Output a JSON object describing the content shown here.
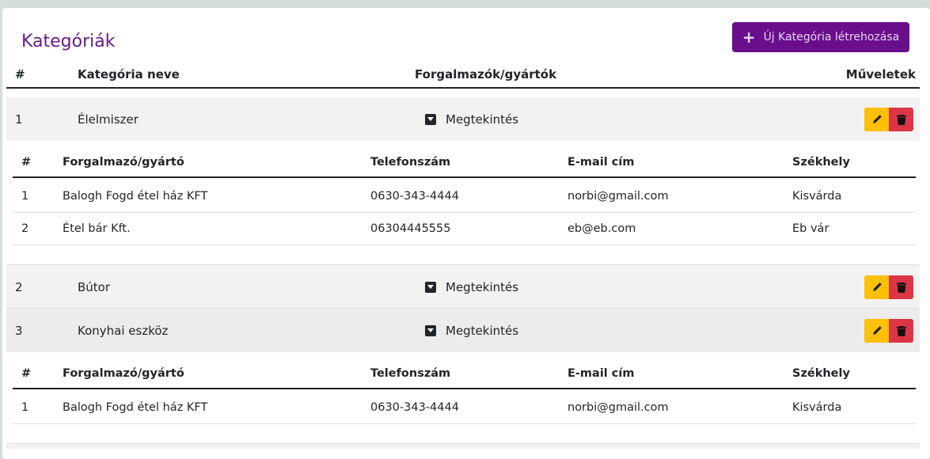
{
  "page": {
    "title": "Kategóriák",
    "new_button_label": "Új Kategória létrehozása",
    "new_button_icon": "plus-icon",
    "accent_color": "#6a0e8c",
    "edit_color": "#ffc107",
    "delete_color": "#dc3545"
  },
  "main_table": {
    "headers": [
      "#",
      "Kategória neve",
      "Forgalmazók/gyártók",
      "Műveletek"
    ],
    "rows": [
      {
        "id": "1",
        "name": "Élelmiszer",
        "toggle_label": "Megtekintés",
        "expanded": true
      },
      {
        "id": "2",
        "name": "Bútor",
        "toggle_label": "Megtekintés",
        "expanded": false
      },
      {
        "id": "3",
        "name": "Konyhai eszköz",
        "toggle_label": "Megtekintés",
        "expanded": true
      }
    ]
  },
  "sub_tables": [
    {
      "headers": [
        "#",
        "Forgalmazó/gyártó",
        "Telefonszám",
        "E-mail cím",
        "Székhely"
      ],
      "rows": [
        [
          "1",
          "Balogh Fogd étel ház KFT",
          "0630-343-4444",
          "norbi@gmail.com",
          "Kisvárda"
        ],
        [
          "2",
          "Étel bár Kft.",
          "06304445555",
          "eb@eb.com",
          "Eb vár"
        ]
      ]
    },
    {
      "headers": [
        "#",
        "Forgalmazó/gyártó",
        "Telefonszám",
        "E-mail cím",
        "Székhely"
      ],
      "rows": [
        [
          "1",
          "Balogh Fogd étel ház KFT",
          "0630-343-4444",
          "norbi@gmail.com",
          "Kisvárda"
        ]
      ]
    }
  ]
}
